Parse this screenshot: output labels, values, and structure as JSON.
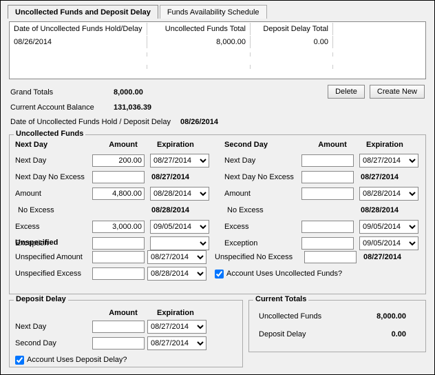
{
  "tabs": {
    "uncollected": "Uncollected Funds and Deposit Delay",
    "availability": "Funds Availability Schedule"
  },
  "table": {
    "headers": {
      "date": "Date of Uncollected Funds Hold/Delay",
      "uf_total": "Uncollected Funds Total",
      "dd_total": "Deposit Delay Total"
    },
    "rows": [
      {
        "date": "08/26/2014",
        "uf_total": "8,000.00",
        "dd_total": "0.00"
      }
    ]
  },
  "summary": {
    "grand_label": "Grand Totals",
    "grand_value": "8,000.00",
    "balance_label": "Current Account Balance",
    "balance_value": "131,036.39"
  },
  "buttons": {
    "delete": "Delete",
    "create": "Create New"
  },
  "date_line": {
    "label": "Date of Uncollected Funds Hold / Deposit Delay",
    "value": "08/26/2014"
  },
  "uf": {
    "legend": "Uncollected Funds",
    "head_next": "Next Day",
    "head_amount": "Amount",
    "head_exp": "Expiration",
    "head_second": "Second Day",
    "left": {
      "r1_lbl": "Next Day",
      "r1_amt": "200.00",
      "r1_exp": "08/27/2014",
      "r2_lbl": "Next Day No Excess",
      "r2_amt": "",
      "r2_exp": "08/27/2014",
      "r3_lbl": "Amount",
      "r3_amt": "4,800.00",
      "r3_exp": "08/28/2014",
      "r4_lbl": "No Excess",
      "r4_amt_blank": "",
      "r4_exp": "08/28/2014",
      "r5_lbl": "Excess",
      "r5_amt": "3,000.00",
      "r5_exp": "09/05/2014",
      "r6_lbl": "Exception",
      "r6_amt": "",
      "r6_exp": ""
    },
    "right": {
      "r1_lbl": "Next Day",
      "r1_amt": "",
      "r1_exp": "08/27/2014",
      "r2_lbl": "Next Day No Excess",
      "r2_amt": "",
      "r2_exp": "08/27/2014",
      "r3_lbl": "Amount",
      "r3_amt": "",
      "r3_exp": "08/28/2014",
      "r4_lbl": "No Excess",
      "r4_amt_blank": "",
      "r4_exp": "08/28/2014",
      "r5_lbl": "Excess",
      "r5_amt": "",
      "r5_exp": "09/05/2014",
      "r6_lbl": "Exception",
      "r6_amt": "",
      "r6_exp": "09/05/2014"
    },
    "unspec_head": "Unspecified",
    "unspec": {
      "amt_lbl": "Unspecified Amount",
      "amt_val": "",
      "amt_exp": "08/27/2014",
      "exc_lbl": "Unspecified Excess",
      "exc_val": "",
      "exc_exp": "08/28/2014",
      "noexc_lbl": "Unspecified No Excess",
      "noexc_val": "",
      "noexc_exp": "08/27/2014",
      "cb_lbl": "Account Uses Uncollected Funds?"
    }
  },
  "dd": {
    "legend": "Deposit Delay",
    "head_amount": "Amount",
    "head_exp": "Expiration",
    "r1_lbl": "Next Day",
    "r1_amt": "",
    "r1_exp": "08/27/2014",
    "r2_lbl": "Second Day",
    "r2_amt": "",
    "r2_exp": "08/27/2014",
    "cb_lbl": "Account Uses Deposit Delay?"
  },
  "ct": {
    "legend": "Current Totals",
    "uf_lbl": "Uncollected Funds",
    "uf_val": "8,000.00",
    "dd_lbl": "Deposit Delay",
    "dd_val": "0.00"
  }
}
